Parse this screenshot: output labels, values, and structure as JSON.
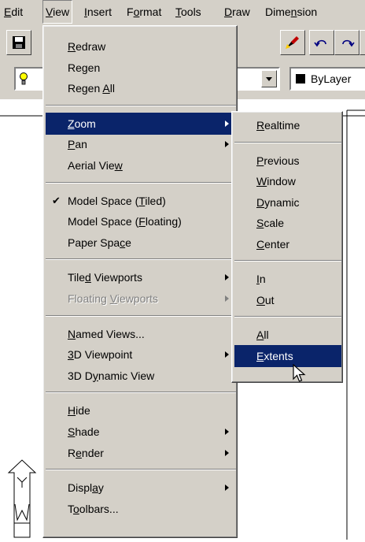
{
  "menubar": [
    {
      "text": "Edit",
      "key": "E",
      "rest": "dit"
    },
    {
      "text": "View",
      "key": "V",
      "rest": "iew"
    },
    {
      "text": "Insert",
      "key": "I",
      "rest": "nsert"
    },
    {
      "text": "Format",
      "pre": "F",
      "key": "o",
      "rest": "rmat"
    },
    {
      "text": "Tools",
      "key": "T",
      "rest": "ools"
    },
    {
      "text": "Draw",
      "key": "D",
      "rest": "raw"
    },
    {
      "text": "Dimension",
      "pre": "Dime",
      "key": "n",
      "rest": "sion"
    }
  ],
  "toolbar": {
    "linetype_value": "ByLayer"
  },
  "view_menu": [
    {
      "pre": "",
      "key": "R",
      "post": "edraw"
    },
    {
      "pre": "Regen",
      "key": "",
      "post": ""
    },
    {
      "pre": "Regen ",
      "key": "A",
      "post": "ll"
    },
    {
      "sep": true
    },
    {
      "pre": "",
      "key": "Z",
      "post": "oom",
      "submenu": true,
      "selected": true
    },
    {
      "pre": "",
      "key": "P",
      "post": "an",
      "submenu": true
    },
    {
      "pre": "Aerial Vie",
      "key": "w",
      "post": ""
    },
    {
      "sep": true
    },
    {
      "pre": "Model Space (",
      "key": "T",
      "post": "iled)",
      "checked": true
    },
    {
      "pre": "Model Space (",
      "key": "F",
      "post": "loating)"
    },
    {
      "pre": "Paper Spa",
      "key": "c",
      "post": "e"
    },
    {
      "sep": true
    },
    {
      "pre": "Tile",
      "key": "d",
      "post": " Viewports",
      "submenu": true
    },
    {
      "pre": "Floating ",
      "key": "V",
      "post": "iewports",
      "submenu": true,
      "disabled": true
    },
    {
      "sep": true
    },
    {
      "pre": "",
      "key": "N",
      "post": "amed Views..."
    },
    {
      "pre": "",
      "key": "3",
      "post": "D Viewpoint",
      "submenu": true
    },
    {
      "pre": "3D D",
      "key": "y",
      "post": "namic View"
    },
    {
      "sep": true
    },
    {
      "pre": "",
      "key": "H",
      "post": "ide"
    },
    {
      "pre": "",
      "key": "S",
      "post": "hade",
      "submenu": true
    },
    {
      "pre": "R",
      "key": "e",
      "post": "nder",
      "submenu": true
    },
    {
      "sep": true
    },
    {
      "pre": "Displ",
      "key": "a",
      "post": "y",
      "submenu": true
    },
    {
      "pre": "T",
      "key": "o",
      "post": "olbars..."
    }
  ],
  "zoom_menu": [
    {
      "pre": "",
      "key": "R",
      "post": "ealtime"
    },
    {
      "sep": true
    },
    {
      "pre": "",
      "key": "P",
      "post": "revious"
    },
    {
      "pre": "",
      "key": "W",
      "post": "indow"
    },
    {
      "pre": "",
      "key": "D",
      "post": "ynamic"
    },
    {
      "pre": "",
      "key": "S",
      "post": "cale"
    },
    {
      "pre": "",
      "key": "C",
      "post": "enter"
    },
    {
      "sep": true
    },
    {
      "pre": "",
      "key": "I",
      "post": "n"
    },
    {
      "pre": "",
      "key": "O",
      "post": "ut"
    },
    {
      "sep": true
    },
    {
      "pre": "",
      "key": "A",
      "post": "ll"
    },
    {
      "pre": "",
      "key": "E",
      "post": "xtents",
      "selected": true
    }
  ]
}
